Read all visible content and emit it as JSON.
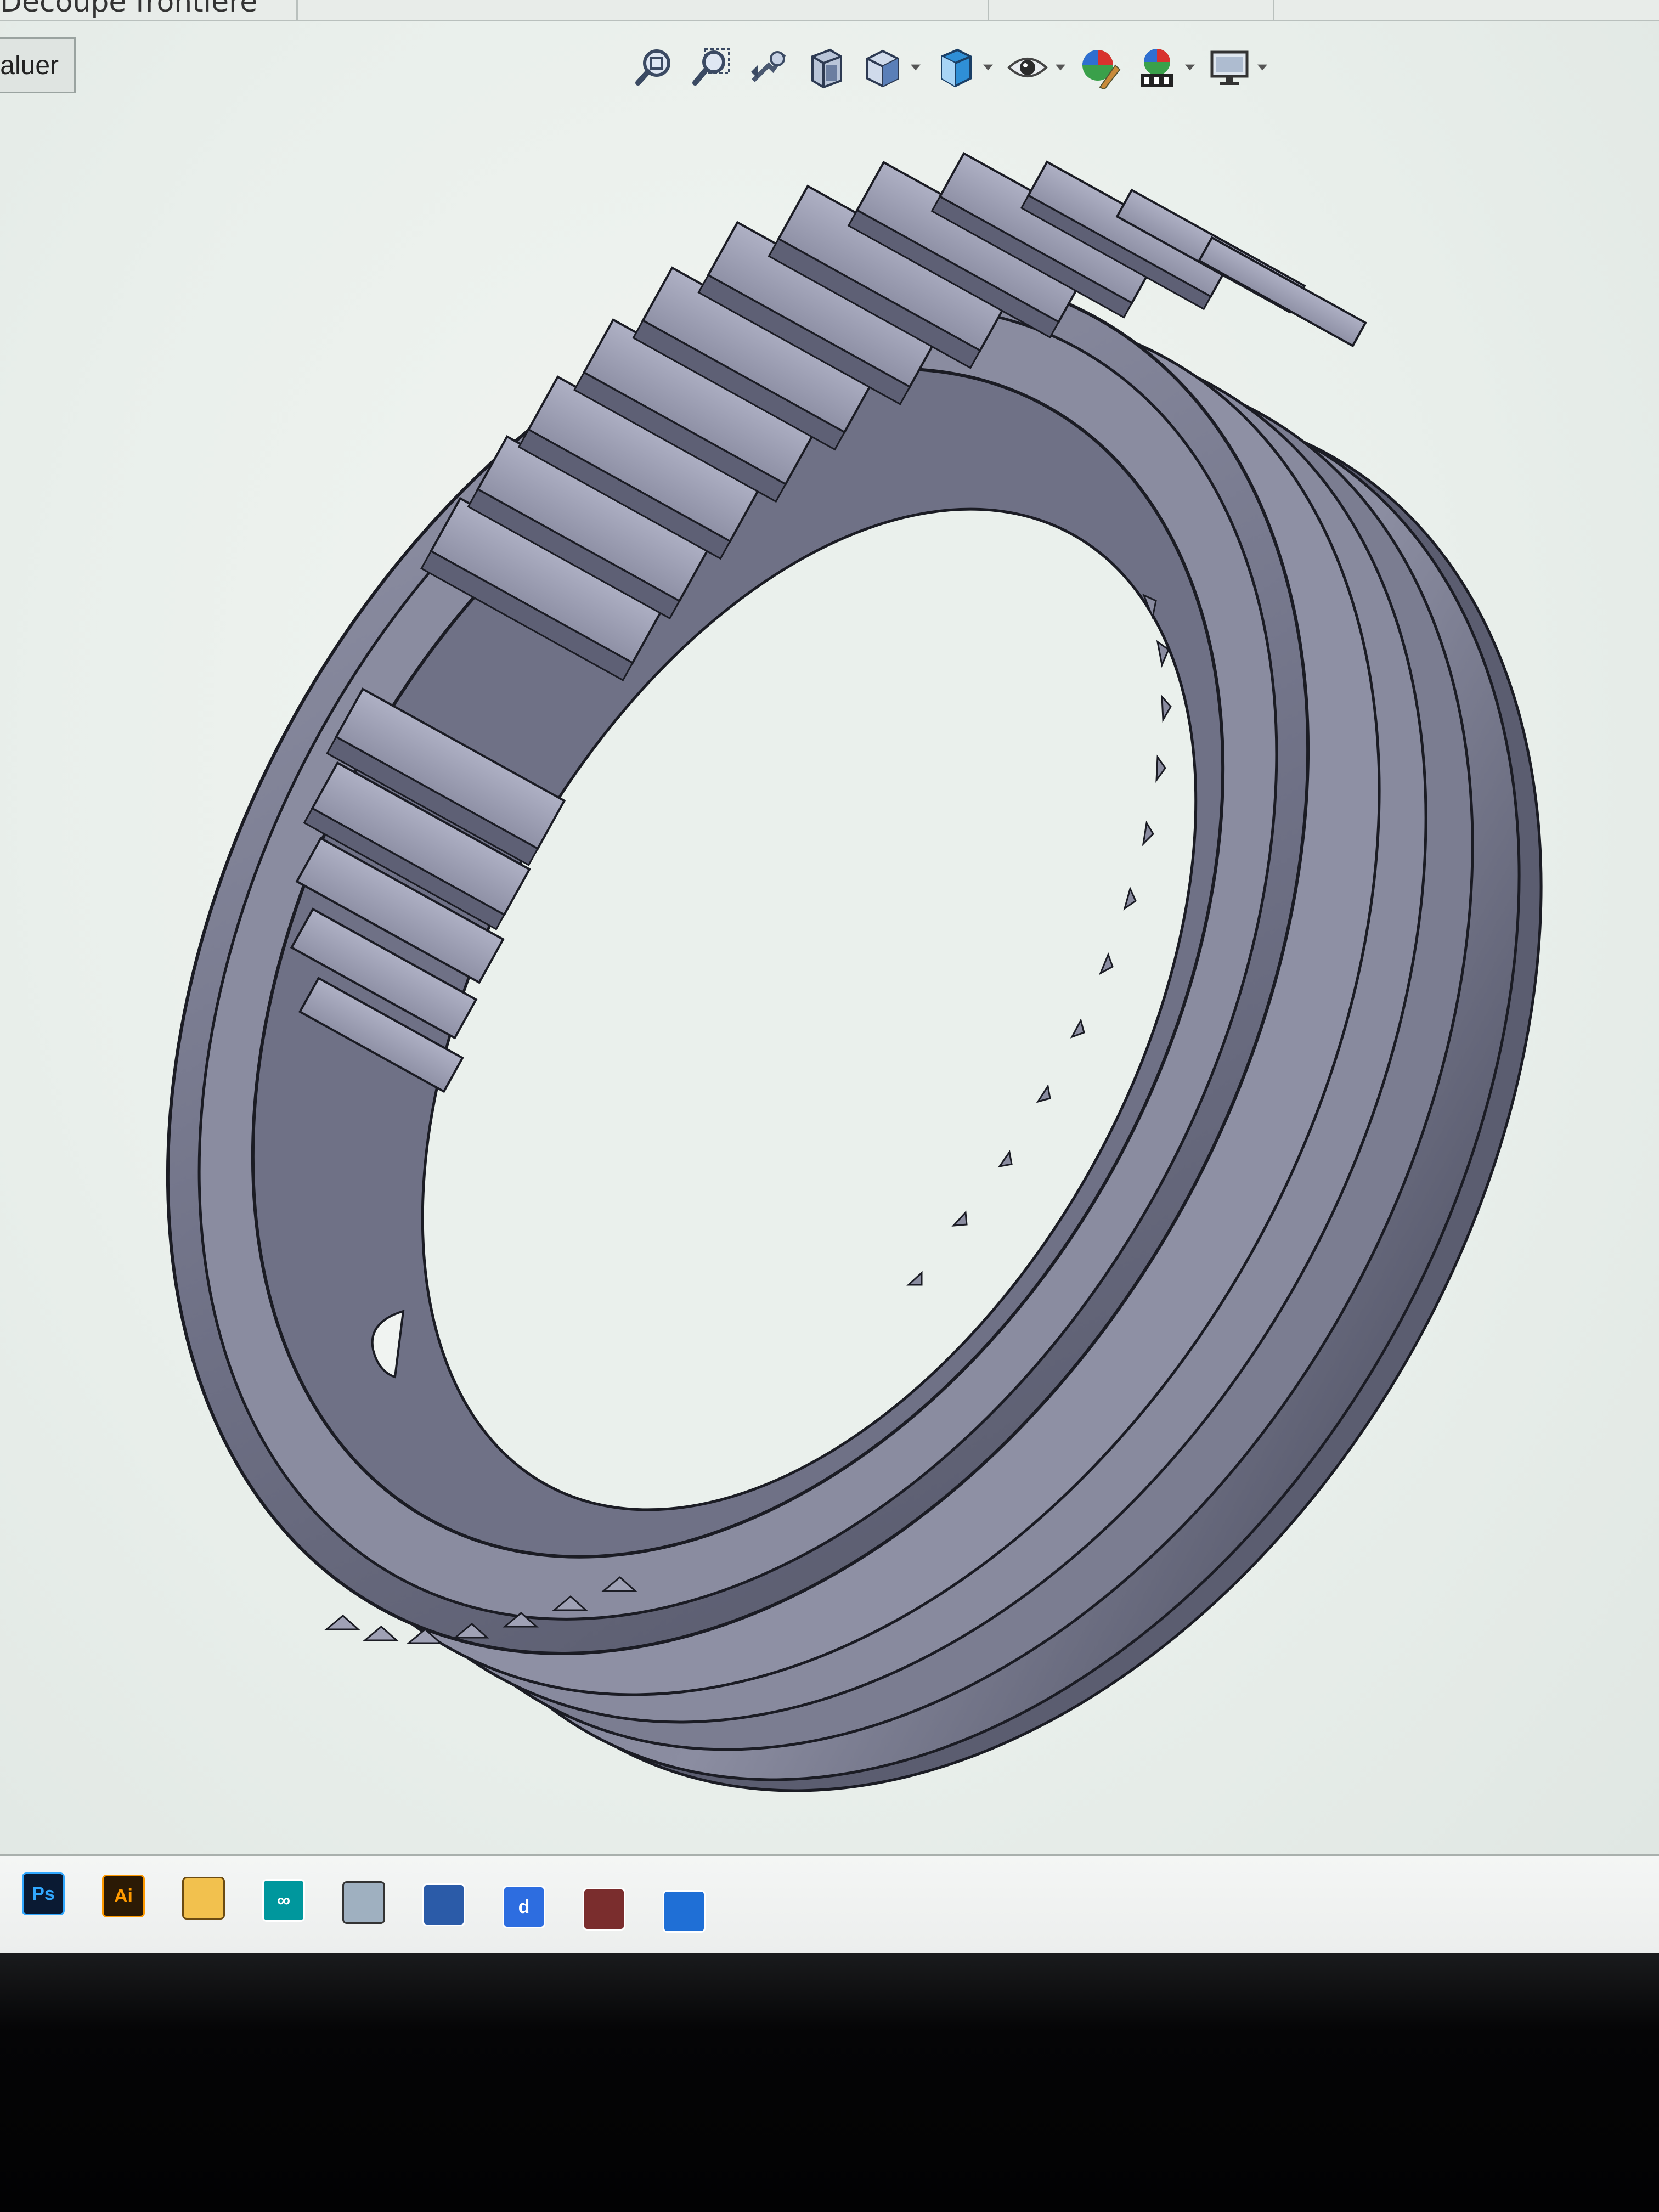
{
  "top_strip": {
    "feature_label": "Découpe frontière"
  },
  "left_tab": {
    "label": "aluer"
  },
  "toolbar": {
    "icons": [
      "zoom-to-fit-icon",
      "zoom-to-area-icon",
      "previous-view-icon",
      "section-view-icon",
      "view-orientation-icon",
      "display-style-icon",
      "hide-show-items-icon",
      "edit-appearance-icon",
      "apply-scene-icon",
      "view-settings-icon"
    ]
  },
  "taskbar": {
    "apps": [
      {
        "name": "photoshop-icon",
        "label": "Ps",
        "bg": "#0a1a33",
        "fg": "#31a8ff"
      },
      {
        "name": "illustrator-icon",
        "label": "Ai",
        "bg": "#2b1a05",
        "fg": "#ff9a00"
      },
      {
        "name": "file-explorer-icon",
        "label": "",
        "bg": "#f2c14e",
        "fg": "#6b4b12"
      },
      {
        "name": "arduino-icon",
        "label": "∞",
        "bg": "#00979d",
        "fg": "#ffffff"
      },
      {
        "name": "app-icon-5",
        "label": "",
        "bg": "#9fb0c0",
        "fg": "#333333"
      },
      {
        "name": "app-icon-6",
        "label": "",
        "bg": "#2b5ba8",
        "fg": "#ffffff"
      },
      {
        "name": "app-icon-7",
        "label": "d",
        "bg": "#2d6de0",
        "fg": "#ffffff"
      },
      {
        "name": "app-icon-8",
        "label": "",
        "bg": "#7a2d2d",
        "fg": "#ffffff"
      },
      {
        "name": "app-icon-9",
        "label": "",
        "bg": "#1f6fd6",
        "fg": "#ffffff"
      }
    ]
  },
  "colors": {
    "part_dark": "#5d5f72",
    "part_mid": "#85879a",
    "part_light": "#b0b2c6",
    "edge": "#1b1c24",
    "background": "#eef2ef"
  }
}
